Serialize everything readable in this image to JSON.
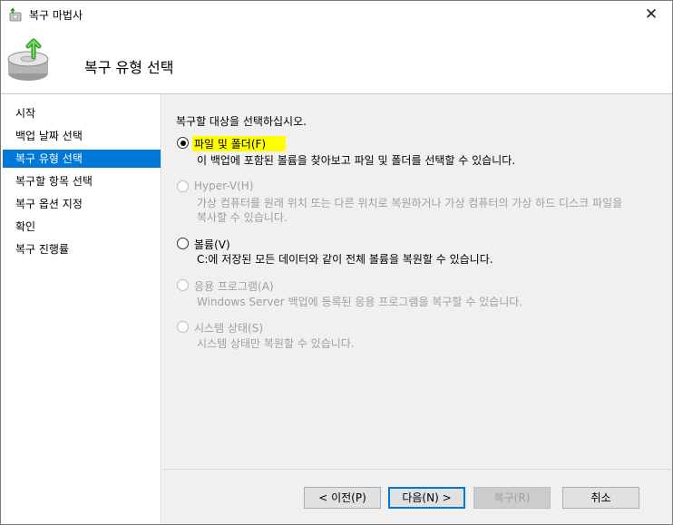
{
  "window": {
    "title": "복구 마법사",
    "close_glyph": "✕"
  },
  "header": {
    "title": "복구 유형 선택",
    "icon": "backup-restore-icon"
  },
  "sidebar": {
    "items": [
      {
        "label": "시작",
        "active": false
      },
      {
        "label": "백업 날짜 선택",
        "active": false
      },
      {
        "label": "복구 유형 선택",
        "active": true
      },
      {
        "label": "복구할 항목 선택",
        "active": false
      },
      {
        "label": "복구 옵션 지정",
        "active": false
      },
      {
        "label": "확인",
        "active": false
      },
      {
        "label": "복구 진행률",
        "active": false
      }
    ]
  },
  "main": {
    "prompt": "복구할 대상을 선택하십시오.",
    "options": [
      {
        "label": "파일 및 폴더(F)",
        "description": "이 백업에 포함된 볼륨을 찾아보고 파일 및 폴더를 선택할 수 있습니다.",
        "checked": true,
        "enabled": true,
        "highlighted": true
      },
      {
        "label": "Hyper-V(H)",
        "description_line1": "가상 컴퓨터를 원래 위치 또는 다른 위치로 복원하거나 가상 컴퓨터의 가상 하드 디스크 파일을",
        "description_line2": "복사할 수 있습니다.",
        "checked": false,
        "enabled": false
      },
      {
        "label": "볼륨(V)",
        "description": "C:에 저장된 모든 데이터와 같이 전체 볼륨을 복원할 수 있습니다.",
        "checked": false,
        "enabled": true
      },
      {
        "label": "응용 프로그램(A)",
        "description": "Windows Server 백업에 등록된 응용 프로그램을 복구할 수 있습니다.",
        "checked": false,
        "enabled": false
      },
      {
        "label": "시스템 상태(S)",
        "description": "시스템 상태만 복원할 수 있습니다.",
        "checked": false,
        "enabled": false
      }
    ]
  },
  "buttons": {
    "previous": "< 이전(P)",
    "next": "다음(N) >",
    "recover": "복구(R)",
    "cancel": "취소"
  },
  "colors": {
    "accent": "#0078d7",
    "highlight": "#ffff00",
    "content_bg": "#f0f0f0",
    "disabled_text": "#a0a0a0"
  }
}
